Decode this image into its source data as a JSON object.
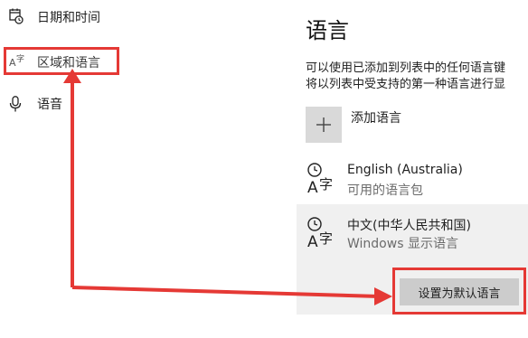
{
  "sidebar": {
    "items": [
      {
        "label": "日期和时间",
        "icon": "calendar-clock-icon"
      },
      {
        "label": "区域和语言",
        "icon": "region-language-icon"
      },
      {
        "label": "语音",
        "icon": "microphone-icon"
      }
    ]
  },
  "main": {
    "title": "语言",
    "description": [
      "可以使用已添加到列表中的任何语言键",
      "将以列表中受支持的第一种语言进行显"
    ],
    "add_language_label": "添加语言",
    "languages": [
      {
        "name": "English (Australia)",
        "status": "可用的语言包",
        "icon": "language-icon"
      },
      {
        "name": "中文(中华人民共和国)",
        "status": "Windows 显示语言",
        "icon": "language-icon"
      }
    ],
    "set_default_button": "设置为默认语言"
  },
  "annotation_color": "#e53935"
}
